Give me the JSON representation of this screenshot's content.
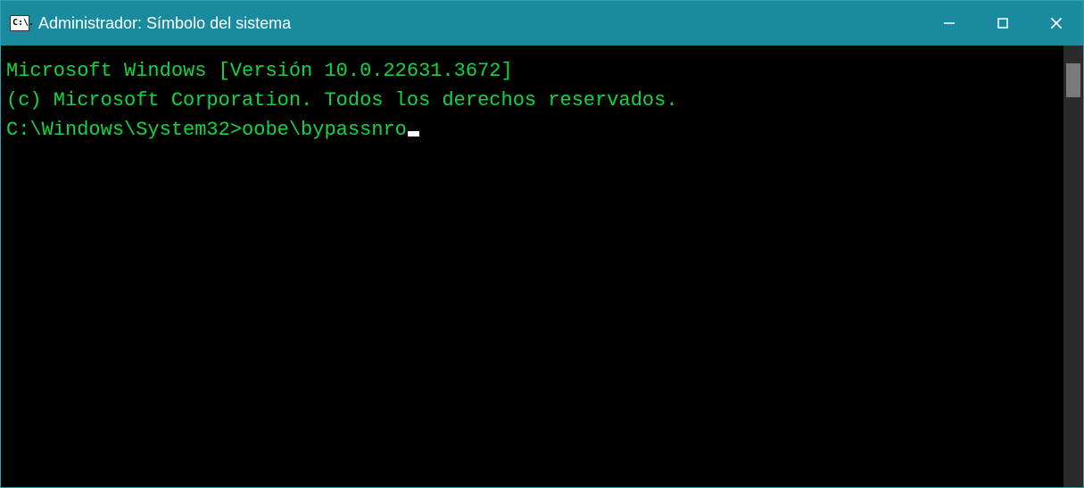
{
  "window": {
    "icon_label": "C:\\.",
    "title": "Administrador: Símbolo del sistema"
  },
  "terminal": {
    "line1": "Microsoft Windows [Versión 10.0.22631.3672]",
    "line2": "(c) Microsoft Corporation. Todos los derechos reservados.",
    "blank": "",
    "prompt": "C:\\Windows\\System32>",
    "command": "oobe\\bypassnro"
  },
  "colors": {
    "titlebar": "#1a8a9e",
    "terminal_bg": "#000000",
    "terminal_fg": "#0fd641"
  }
}
